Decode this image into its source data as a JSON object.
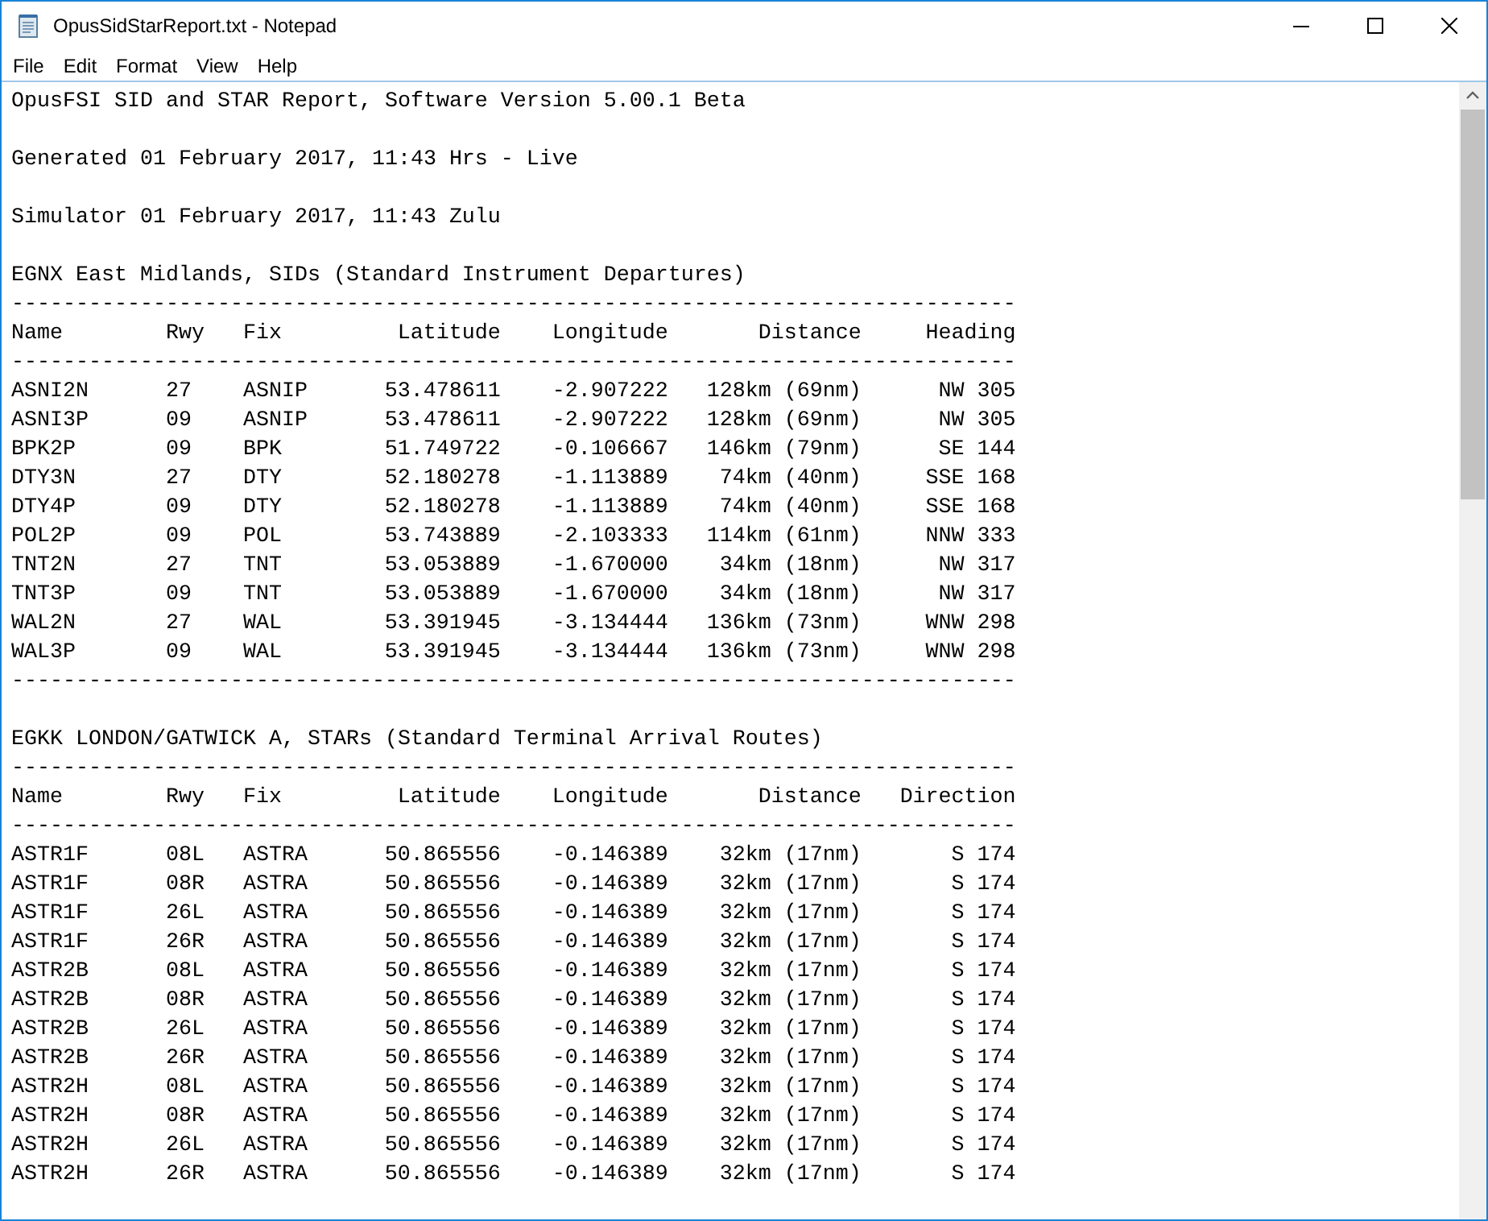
{
  "window": {
    "title": "OpusSidStarReport.txt - Notepad"
  },
  "menu": [
    {
      "label": "File"
    },
    {
      "label": "Edit"
    },
    {
      "label": "Format"
    },
    {
      "label": "View"
    },
    {
      "label": "Help"
    }
  ],
  "lines": [
    {
      "kind": "text",
      "text": "OpusFSI SID and STAR Report, Software Version 5.00.1 Beta"
    },
    {
      "kind": "blank"
    },
    {
      "kind": "text",
      "text": "Generated 01 February 2017, 11:43 Hrs - Live"
    },
    {
      "kind": "blank"
    },
    {
      "kind": "text",
      "text": "Simulator 01 February 2017, 11:43 Zulu"
    },
    {
      "kind": "blank"
    },
    {
      "kind": "text",
      "text": "EGNX East Midlands, SIDs (Standard Instrument Departures)"
    },
    {
      "kind": "rule",
      "text": "------------------------------------------------------------------------------"
    },
    {
      "kind": "header",
      "cells": [
        "Name",
        "Rwy",
        "Fix",
        "Latitude",
        "Longitude",
        "Distance",
        "Heading"
      ]
    },
    {
      "kind": "rule",
      "text": "------------------------------------------------------------------------------"
    },
    {
      "kind": "row",
      "cells": [
        "ASNI2N",
        "27",
        "ASNIP",
        "53.478611",
        "-2.907222",
        "128km (69nm)",
        "NW 305"
      ]
    },
    {
      "kind": "row",
      "cells": [
        "ASNI3P",
        "09",
        "ASNIP",
        "53.478611",
        "-2.907222",
        "128km (69nm)",
        "NW 305"
      ]
    },
    {
      "kind": "row",
      "cells": [
        "BPK2P",
        "09",
        "BPK",
        "51.749722",
        "-0.106667",
        "146km (79nm)",
        "SE 144"
      ]
    },
    {
      "kind": "row",
      "cells": [
        "DTY3N",
        "27",
        "DTY",
        "52.180278",
        "-1.113889",
        "74km (40nm)",
        "SSE 168"
      ]
    },
    {
      "kind": "row",
      "cells": [
        "DTY4P",
        "09",
        "DTY",
        "52.180278",
        "-1.113889",
        "74km (40nm)",
        "SSE 168"
      ]
    },
    {
      "kind": "row",
      "cells": [
        "POL2P",
        "09",
        "POL",
        "53.743889",
        "-2.103333",
        "114km (61nm)",
        "NNW 333"
      ]
    },
    {
      "kind": "row",
      "cells": [
        "TNT2N",
        "27",
        "TNT",
        "53.053889",
        "-1.670000",
        "34km (18nm)",
        "NW 317"
      ]
    },
    {
      "kind": "row",
      "cells": [
        "TNT3P",
        "09",
        "TNT",
        "53.053889",
        "-1.670000",
        "34km (18nm)",
        "NW 317"
      ]
    },
    {
      "kind": "row",
      "cells": [
        "WAL2N",
        "27",
        "WAL",
        "53.391945",
        "-3.134444",
        "136km (73nm)",
        "WNW 298"
      ]
    },
    {
      "kind": "row",
      "cells": [
        "WAL3P",
        "09",
        "WAL",
        "53.391945",
        "-3.134444",
        "136km (73nm)",
        "WNW 298"
      ]
    },
    {
      "kind": "rule",
      "text": "------------------------------------------------------------------------------"
    },
    {
      "kind": "blank"
    },
    {
      "kind": "text",
      "text": "EGKK LONDON/GATWICK A, STARs (Standard Terminal Arrival Routes)"
    },
    {
      "kind": "rule",
      "text": "------------------------------------------------------------------------------"
    },
    {
      "kind": "header",
      "cells": [
        "Name",
        "Rwy",
        "Fix",
        "Latitude",
        "Longitude",
        "Distance",
        "Direction"
      ]
    },
    {
      "kind": "rule",
      "text": "------------------------------------------------------------------------------"
    },
    {
      "kind": "row",
      "cells": [
        "ASTR1F",
        "08L",
        "ASTRA",
        "50.865556",
        "-0.146389",
        "32km (17nm)",
        "S 174"
      ]
    },
    {
      "kind": "row",
      "cells": [
        "ASTR1F",
        "08R",
        "ASTRA",
        "50.865556",
        "-0.146389",
        "32km (17nm)",
        "S 174"
      ]
    },
    {
      "kind": "row",
      "cells": [
        "ASTR1F",
        "26L",
        "ASTRA",
        "50.865556",
        "-0.146389",
        "32km (17nm)",
        "S 174"
      ]
    },
    {
      "kind": "row",
      "cells": [
        "ASTR1F",
        "26R",
        "ASTRA",
        "50.865556",
        "-0.146389",
        "32km (17nm)",
        "S 174"
      ]
    },
    {
      "kind": "row",
      "cells": [
        "ASTR2B",
        "08L",
        "ASTRA",
        "50.865556",
        "-0.146389",
        "32km (17nm)",
        "S 174"
      ]
    },
    {
      "kind": "row",
      "cells": [
        "ASTR2B",
        "08R",
        "ASTRA",
        "50.865556",
        "-0.146389",
        "32km (17nm)",
        "S 174"
      ]
    },
    {
      "kind": "row",
      "cells": [
        "ASTR2B",
        "26L",
        "ASTRA",
        "50.865556",
        "-0.146389",
        "32km (17nm)",
        "S 174"
      ]
    },
    {
      "kind": "row",
      "cells": [
        "ASTR2B",
        "26R",
        "ASTRA",
        "50.865556",
        "-0.146389",
        "32km (17nm)",
        "S 174"
      ]
    },
    {
      "kind": "row",
      "cells": [
        "ASTR2H",
        "08L",
        "ASTRA",
        "50.865556",
        "-0.146389",
        "32km (17nm)",
        "S 174"
      ]
    },
    {
      "kind": "row",
      "cells": [
        "ASTR2H",
        "08R",
        "ASTRA",
        "50.865556",
        "-0.146389",
        "32km (17nm)",
        "S 174"
      ]
    },
    {
      "kind": "row",
      "cells": [
        "ASTR2H",
        "26L",
        "ASTRA",
        "50.865556",
        "-0.146389",
        "32km (17nm)",
        "S 174"
      ]
    },
    {
      "kind": "row",
      "cells": [
        "ASTR2H",
        "26R",
        "ASTRA",
        "50.865556",
        "-0.146389",
        "32km (17nm)",
        "S 174"
      ]
    }
  ]
}
